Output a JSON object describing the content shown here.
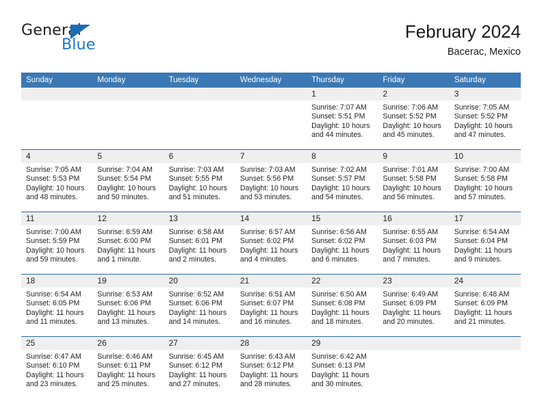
{
  "brand": {
    "name_part1": "General",
    "name_part2": "Blue",
    "triangle_color": "#1a6cb5",
    "blue_color": "#1878c8"
  },
  "header": {
    "title": "February 2024",
    "location": "Bacerac, Mexico"
  },
  "theme": {
    "header_blue": "#3b78b4",
    "row_divider_blue": "#2a68a8",
    "daynum_band_gray": "#efefef"
  },
  "weekday_headers": [
    "Sunday",
    "Monday",
    "Tuesday",
    "Wednesday",
    "Thursday",
    "Friday",
    "Saturday"
  ],
  "labels": {
    "sunrise_prefix": "Sunrise:",
    "sunset_prefix": "Sunset:",
    "daylight_prefix": "Daylight:"
  },
  "weeks": [
    [
      {
        "day": "",
        "empty": true
      },
      {
        "day": "",
        "empty": true
      },
      {
        "day": "",
        "empty": true
      },
      {
        "day": "",
        "empty": true
      },
      {
        "day": "1",
        "sunrise": "Sunrise: 7:07 AM",
        "sunset": "Sunset: 5:51 PM",
        "daylight_line1": "Daylight: 10 hours",
        "daylight_line2": "and 44 minutes."
      },
      {
        "day": "2",
        "sunrise": "Sunrise: 7:06 AM",
        "sunset": "Sunset: 5:52 PM",
        "daylight_line1": "Daylight: 10 hours",
        "daylight_line2": "and 45 minutes."
      },
      {
        "day": "3",
        "sunrise": "Sunrise: 7:05 AM",
        "sunset": "Sunset: 5:52 PM",
        "daylight_line1": "Daylight: 10 hours",
        "daylight_line2": "and 47 minutes."
      }
    ],
    [
      {
        "day": "4",
        "sunrise": "Sunrise: 7:05 AM",
        "sunset": "Sunset: 5:53 PM",
        "daylight_line1": "Daylight: 10 hours",
        "daylight_line2": "and 48 minutes."
      },
      {
        "day": "5",
        "sunrise": "Sunrise: 7:04 AM",
        "sunset": "Sunset: 5:54 PM",
        "daylight_line1": "Daylight: 10 hours",
        "daylight_line2": "and 50 minutes."
      },
      {
        "day": "6",
        "sunrise": "Sunrise: 7:03 AM",
        "sunset": "Sunset: 5:55 PM",
        "daylight_line1": "Daylight: 10 hours",
        "daylight_line2": "and 51 minutes."
      },
      {
        "day": "7",
        "sunrise": "Sunrise: 7:03 AM",
        "sunset": "Sunset: 5:56 PM",
        "daylight_line1": "Daylight: 10 hours",
        "daylight_line2": "and 53 minutes."
      },
      {
        "day": "8",
        "sunrise": "Sunrise: 7:02 AM",
        "sunset": "Sunset: 5:57 PM",
        "daylight_line1": "Daylight: 10 hours",
        "daylight_line2": "and 54 minutes."
      },
      {
        "day": "9",
        "sunrise": "Sunrise: 7:01 AM",
        "sunset": "Sunset: 5:58 PM",
        "daylight_line1": "Daylight: 10 hours",
        "daylight_line2": "and 56 minutes."
      },
      {
        "day": "10",
        "sunrise": "Sunrise: 7:00 AM",
        "sunset": "Sunset: 5:58 PM",
        "daylight_line1": "Daylight: 10 hours",
        "daylight_line2": "and 57 minutes."
      }
    ],
    [
      {
        "day": "11",
        "sunrise": "Sunrise: 7:00 AM",
        "sunset": "Sunset: 5:59 PM",
        "daylight_line1": "Daylight: 10 hours",
        "daylight_line2": "and 59 minutes."
      },
      {
        "day": "12",
        "sunrise": "Sunrise: 6:59 AM",
        "sunset": "Sunset: 6:00 PM",
        "daylight_line1": "Daylight: 11 hours",
        "daylight_line2": "and 1 minute."
      },
      {
        "day": "13",
        "sunrise": "Sunrise: 6:58 AM",
        "sunset": "Sunset: 6:01 PM",
        "daylight_line1": "Daylight: 11 hours",
        "daylight_line2": "and 2 minutes."
      },
      {
        "day": "14",
        "sunrise": "Sunrise: 6:57 AM",
        "sunset": "Sunset: 6:02 PM",
        "daylight_line1": "Daylight: 11 hours",
        "daylight_line2": "and 4 minutes."
      },
      {
        "day": "15",
        "sunrise": "Sunrise: 6:56 AM",
        "sunset": "Sunset: 6:02 PM",
        "daylight_line1": "Daylight: 11 hours",
        "daylight_line2": "and 6 minutes."
      },
      {
        "day": "16",
        "sunrise": "Sunrise: 6:55 AM",
        "sunset": "Sunset: 6:03 PM",
        "daylight_line1": "Daylight: 11 hours",
        "daylight_line2": "and 7 minutes."
      },
      {
        "day": "17",
        "sunrise": "Sunrise: 6:54 AM",
        "sunset": "Sunset: 6:04 PM",
        "daylight_line1": "Daylight: 11 hours",
        "daylight_line2": "and 9 minutes."
      }
    ],
    [
      {
        "day": "18",
        "sunrise": "Sunrise: 6:54 AM",
        "sunset": "Sunset: 6:05 PM",
        "daylight_line1": "Daylight: 11 hours",
        "daylight_line2": "and 11 minutes."
      },
      {
        "day": "19",
        "sunrise": "Sunrise: 6:53 AM",
        "sunset": "Sunset: 6:06 PM",
        "daylight_line1": "Daylight: 11 hours",
        "daylight_line2": "and 13 minutes."
      },
      {
        "day": "20",
        "sunrise": "Sunrise: 6:52 AM",
        "sunset": "Sunset: 6:06 PM",
        "daylight_line1": "Daylight: 11 hours",
        "daylight_line2": "and 14 minutes."
      },
      {
        "day": "21",
        "sunrise": "Sunrise: 6:51 AM",
        "sunset": "Sunset: 6:07 PM",
        "daylight_line1": "Daylight: 11 hours",
        "daylight_line2": "and 16 minutes."
      },
      {
        "day": "22",
        "sunrise": "Sunrise: 6:50 AM",
        "sunset": "Sunset: 6:08 PM",
        "daylight_line1": "Daylight: 11 hours",
        "daylight_line2": "and 18 minutes."
      },
      {
        "day": "23",
        "sunrise": "Sunrise: 6:49 AM",
        "sunset": "Sunset: 6:09 PM",
        "daylight_line1": "Daylight: 11 hours",
        "daylight_line2": "and 20 minutes."
      },
      {
        "day": "24",
        "sunrise": "Sunrise: 6:48 AM",
        "sunset": "Sunset: 6:09 PM",
        "daylight_line1": "Daylight: 11 hours",
        "daylight_line2": "and 21 minutes."
      }
    ],
    [
      {
        "day": "25",
        "sunrise": "Sunrise: 6:47 AM",
        "sunset": "Sunset: 6:10 PM",
        "daylight_line1": "Daylight: 11 hours",
        "daylight_line2": "and 23 minutes."
      },
      {
        "day": "26",
        "sunrise": "Sunrise: 6:46 AM",
        "sunset": "Sunset: 6:11 PM",
        "daylight_line1": "Daylight: 11 hours",
        "daylight_line2": "and 25 minutes."
      },
      {
        "day": "27",
        "sunrise": "Sunrise: 6:45 AM",
        "sunset": "Sunset: 6:12 PM",
        "daylight_line1": "Daylight: 11 hours",
        "daylight_line2": "and 27 minutes."
      },
      {
        "day": "28",
        "sunrise": "Sunrise: 6:43 AM",
        "sunset": "Sunset: 6:12 PM",
        "daylight_line1": "Daylight: 11 hours",
        "daylight_line2": "and 28 minutes."
      },
      {
        "day": "29",
        "sunrise": "Sunrise: 6:42 AM",
        "sunset": "Sunset: 6:13 PM",
        "daylight_line1": "Daylight: 11 hours",
        "daylight_line2": "and 30 minutes."
      },
      {
        "day": "",
        "empty": true
      },
      {
        "day": "",
        "empty": true
      }
    ]
  ]
}
